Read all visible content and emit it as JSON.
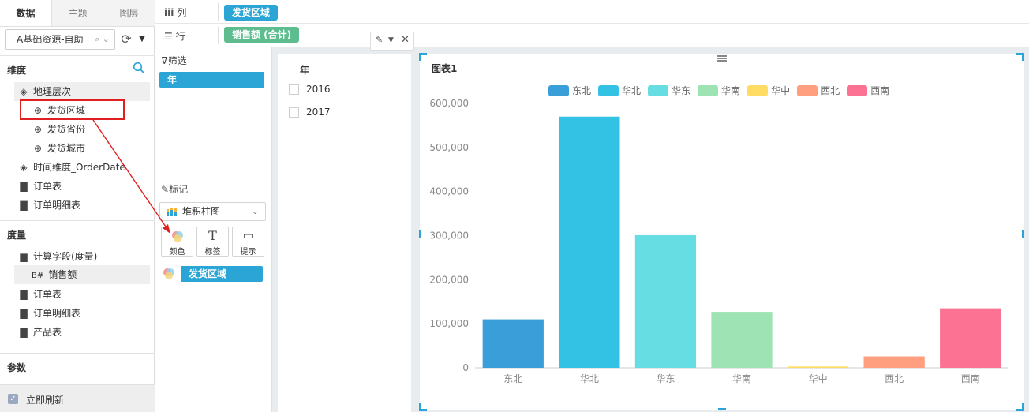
{
  "left_panel": {
    "tabs": [
      "数据",
      "主题",
      "图层"
    ],
    "datasource": "A基础资源-自助",
    "dimensions": {
      "title": "维度",
      "items": [
        {
          "label": "地理层次",
          "icon": "layers-icon"
        },
        {
          "label": "发货区域",
          "icon": "globe-icon"
        },
        {
          "label": "发货省份",
          "icon": "globe-icon"
        },
        {
          "label": "发货城市",
          "icon": "globe-icon"
        },
        {
          "label": "时间维度_OrderDate",
          "icon": "layers-icon"
        },
        {
          "label": "订单表",
          "icon": "folder-icon"
        },
        {
          "label": "订单明细表",
          "icon": "folder-icon"
        }
      ]
    },
    "measures": {
      "title": "度量",
      "items": [
        {
          "label": "计算字段(度量)",
          "icon": "folder-open-icon"
        },
        {
          "label": "销售额",
          "icon": "measure-icon",
          "prefix": "B#"
        },
        {
          "label": "订单表",
          "icon": "folder-icon"
        },
        {
          "label": "订单明细表",
          "icon": "folder-icon"
        },
        {
          "label": "产品表",
          "icon": "folder-icon"
        }
      ]
    },
    "params_title": "参数",
    "auto_refresh": "立即刷新"
  },
  "shelves": {
    "columns_label": "列",
    "rows_label": "行",
    "columns_pill": "发货区域",
    "rows_pill": "销售额 (合计)"
  },
  "filter_panel": {
    "title": "筛选",
    "pill": "年"
  },
  "marks_panel": {
    "title": "标记",
    "chart_type": "堆积柱图",
    "buttons": [
      "颜色",
      "标签",
      "提示"
    ],
    "color_pill": "发货区域"
  },
  "filter_box": {
    "header": "年",
    "items": [
      "2016",
      "2017"
    ]
  },
  "colors": {
    "accent": "#2aa5d6",
    "pill_green": "#5dbd8f",
    "highlight_red": "#e02020"
  },
  "chart_data": {
    "type": "bar",
    "title": "图表1",
    "categories": [
      "东北",
      "华北",
      "华东",
      "华南",
      "华中",
      "西北",
      "西南"
    ],
    "values": [
      110000,
      570000,
      301000,
      127000,
      3000,
      26000,
      135000
    ],
    "colors": [
      "#3a9fd8",
      "#33c1e4",
      "#66dde3",
      "#9ee3b3",
      "#ffdc64",
      "#ff9f7f",
      "#fb7293"
    ],
    "ylim": [
      0,
      600000
    ],
    "yticks": [
      "0",
      "100,000",
      "200,000",
      "300,000",
      "400,000",
      "500,000",
      "600,000"
    ],
    "legend": [
      "东北",
      "华北",
      "华东",
      "华南",
      "华中",
      "西北",
      "西南"
    ],
    "legend_position": "top-center",
    "grid": false
  }
}
